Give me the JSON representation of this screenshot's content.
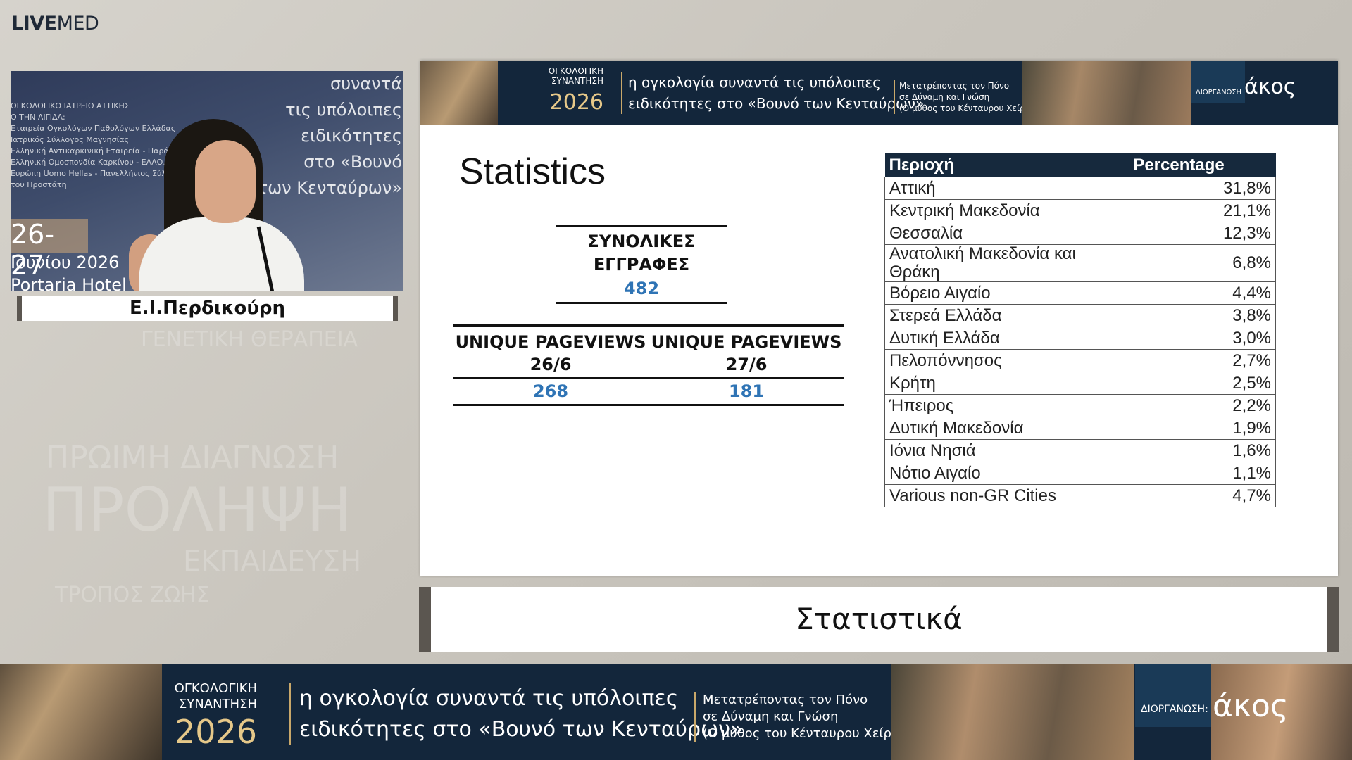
{
  "logo": {
    "bold": "LIVE",
    "rest": "MED"
  },
  "background": {
    "words": [
      "ΓΕΝΕΤΙΚΗ ΘΕΡΑΠΕΙΑ",
      "ΠΡΩΙΜΗ ΔΙΑΓΝΩΣΗ",
      "ΠΡΟΛΗΨΗ",
      "ΕΚΠΑΙΔΕΥΣΗ",
      "ΤΡΟΠΟΣ ΖΩΗΣ"
    ]
  },
  "video": {
    "left_lines": [
      "ΟΓΚΟΛΟΓΙΚΟ ΙΑΤΡΕΙΟ ΑΤΤΙΚΗΣ",
      "Ο ΤΗΝ ΑΙΓΙΔΑ:",
      "Εταιρεία Ογκολόγων Παθολόγων Ελλάδας",
      "Ιατρικός Σύλλογος Μαγνησίας",
      "Ελληνική Αντικαρκινική Εταιρεία - Παράρτημα Ν. Μαγνησίας",
      "Ελληνική Ομοσπονδία Καρκίνου - ΕΛΛΟ.Κ.",
      "Ευρώπη Uomo Hellas - Πανελλήνιος Σύλλογος για τον Καρκίνο",
      "του Προστάτη"
    ],
    "right_lines": [
      "συναντά",
      "τις υπόλοιπες",
      "ειδικότητες",
      "στο «Βουνό",
      "των Κενταύρων»"
    ],
    "date": "26-27",
    "month": "Ιουνίου 2026",
    "hotel": "Portaria Hotel"
  },
  "speaker_name": "Ε.Ι.Περδικούρη",
  "slide": {
    "banner": {
      "conference": "ΟΓΚΟΛΟΓΙΚΗ\nΣΥΝΑΝΤΗΣΗ",
      "year": "2026",
      "tagline_1": "η ογκολογία συναντά τις υπόλοιπες",
      "tagline_2": "ειδικότητες στο «Βουνό των Κενταύρων»",
      "sub_1": "Μετατρέποντας τον Πόνο",
      "sub_2": "σε Δύναμη και Γνώση",
      "sub_3": "(Ο μύθος του Κένταυρου Χείρωνα)",
      "organizer": "ΔΙΟΡΓΑΝΩΣΗ",
      "org_logo": "άκος"
    },
    "title": "Statistics",
    "registrations": {
      "label": "ΣΥΝΟΛΙΚΕΣ\nΕΓΓΡΑΦΕΣ",
      "value": "482"
    },
    "pageviews": {
      "headers": [
        "UNIQUE PAGEVIEWS\n26/6",
        "UNIQUE PAGEVIEWS\n27/6"
      ],
      "values": [
        "268",
        "181"
      ]
    },
    "table": {
      "headers": [
        "Περιοχή",
        "Percentage"
      ],
      "rows": [
        [
          "Αττική",
          "31,8%"
        ],
        [
          "Κεντρική Μακεδονία",
          "21,1%"
        ],
        [
          "Θεσσαλία",
          "12,3%"
        ],
        [
          "Ανατολική Μακεδονία και Θράκη",
          "6,8%"
        ],
        [
          "Βόρειο Αιγαίο",
          "4,4%"
        ],
        [
          "Στερεά Ελλάδα",
          "3,8%"
        ],
        [
          "Δυτική Ελλάδα",
          "3,0%"
        ],
        [
          "Πελοπόννησος",
          "2,7%"
        ],
        [
          "Κρήτη",
          "2,5%"
        ],
        [
          "Ήπειρος",
          "2,2%"
        ],
        [
          "Δυτική Μακεδονία",
          "1,9%"
        ],
        [
          "Ιόνια Νησιά",
          "1,6%"
        ],
        [
          "Νότιο Αιγαίο",
          "1,1%"
        ],
        [
          "Various non-GR Cities",
          "4,7%"
        ]
      ]
    }
  },
  "caption": "Στατιστικά",
  "bottom_banner": {
    "conference": "ΟΓΚΟΛΟΓΙΚΗ\nΣΥΝΑΝΤΗΣΗ",
    "year": "2026",
    "tagline_1": "η ογκολογία συναντά τις υπόλοιπες",
    "tagline_2": "ειδικότητες στο «Βουνό των Κενταύρων»",
    "sub_1": "Μετατρέποντας τον Πόνο",
    "sub_2": "σε Δύναμη και Γνώση",
    "sub_3": "(Ο μύθος του Κένταυρου Χείρωνα)",
    "organizer": "ΔΙΟΡΓΑΝΩΣΗ:",
    "org_logo": "άκος"
  },
  "colors": {
    "accent_blue": "#2f74b5",
    "banner_navy": "#13263b",
    "gold": "#e6c889"
  }
}
